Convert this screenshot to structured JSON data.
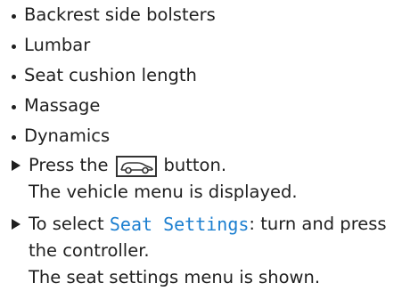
{
  "bullets": [
    "Backrest side bolsters",
    "Lumbar",
    "Seat cushion length",
    "Massage",
    "Dynamics"
  ],
  "steps": [
    {
      "before_icon": "Press the",
      "icon": "car-icon",
      "after_icon": "button.",
      "result": "The vehicle menu is displayed."
    },
    {
      "before_term": "To select",
      "term": "Seat Settings",
      "after_term": ": turn and press",
      "continuation": "the controller.",
      "result": "The seat settings menu is shown."
    }
  ],
  "colors": {
    "text": "#1f1f1f",
    "menu_term": "#1c7fd0"
  }
}
